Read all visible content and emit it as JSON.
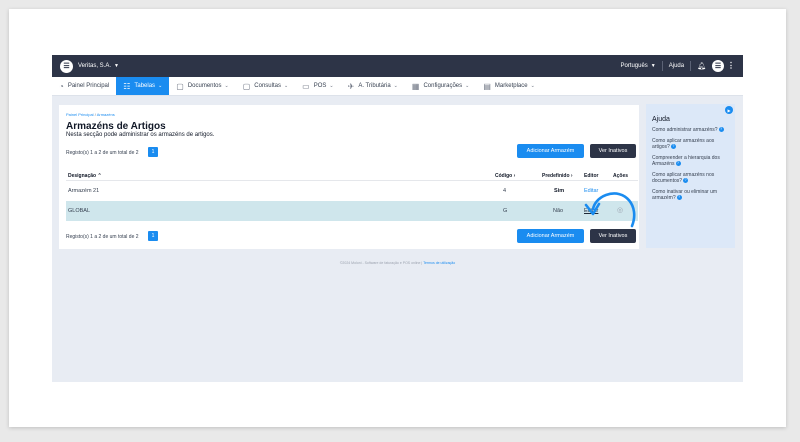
{
  "topbar": {
    "company": "Veritas, S.A.",
    "language": "Português",
    "help": "Ajuda",
    "logo_icon": "doc-logo-icon"
  },
  "menu": [
    {
      "label": "Painel Principal",
      "icon": "◔"
    },
    {
      "label": "Tabelas",
      "icon": "☷",
      "caret": "⌄",
      "active": true
    },
    {
      "label": "Documentos",
      "icon": "▢",
      "caret": "⌄"
    },
    {
      "label": "Consultas",
      "icon": "▢",
      "caret": "⌄"
    },
    {
      "label": "POS",
      "icon": "▭",
      "caret": "⌄"
    },
    {
      "label": "A. Tributária",
      "icon": "✈",
      "caret": "⌄"
    },
    {
      "label": "Configurações",
      "icon": "▦",
      "caret": "⌄"
    },
    {
      "label": "Marketplace",
      "icon": "▤",
      "caret": "⌄"
    }
  ],
  "breadcrumb": {
    "home": "Painel Principal",
    "separator": "/",
    "current": "Armazéns"
  },
  "page": {
    "title": "Armazéns de Artigos",
    "subtitle": "Nesta secção pode administrar os armazéns de artigos.",
    "records_top": "Registo(s) 1 a 2 de um total de 2",
    "records_bottom": "Registo(s) 1 a 2 de um total de 2",
    "page_number": "1",
    "add_button": "Adicionar Armazém",
    "inactive_button": "Ver Inativos"
  },
  "table": {
    "headers": {
      "designacao": "Designação",
      "codigo": "Código",
      "predefinido": "Predefinido",
      "editor": "Editor",
      "acoes": "Ações"
    },
    "rows": [
      {
        "designacao": "Armazém 21",
        "codigo": "4",
        "predefinido": "Sim",
        "editor": "Editar"
      },
      {
        "designacao": "GLOBAL",
        "codigo": "G",
        "predefinido": "Não",
        "editor": "Editar"
      }
    ]
  },
  "help": {
    "title": "Ajuda",
    "items": [
      "Como administrar armazéns?",
      "Como aplicar armazéns aos artigos?",
      "Compreender a hierarquia dos Armazéns",
      "Como aplicar armazéns nos documentos?",
      "Como inativar ou eliminar um armazém?"
    ]
  },
  "footer": {
    "text": "©2024 Moloni - Software de faturação e POS online |",
    "link": "Termos de utilização"
  },
  "colors": {
    "accent": "#1a8cf0",
    "dark": "#2d3447",
    "highlight_row": "#cfe6ec",
    "help_bg": "#dce8f8"
  }
}
